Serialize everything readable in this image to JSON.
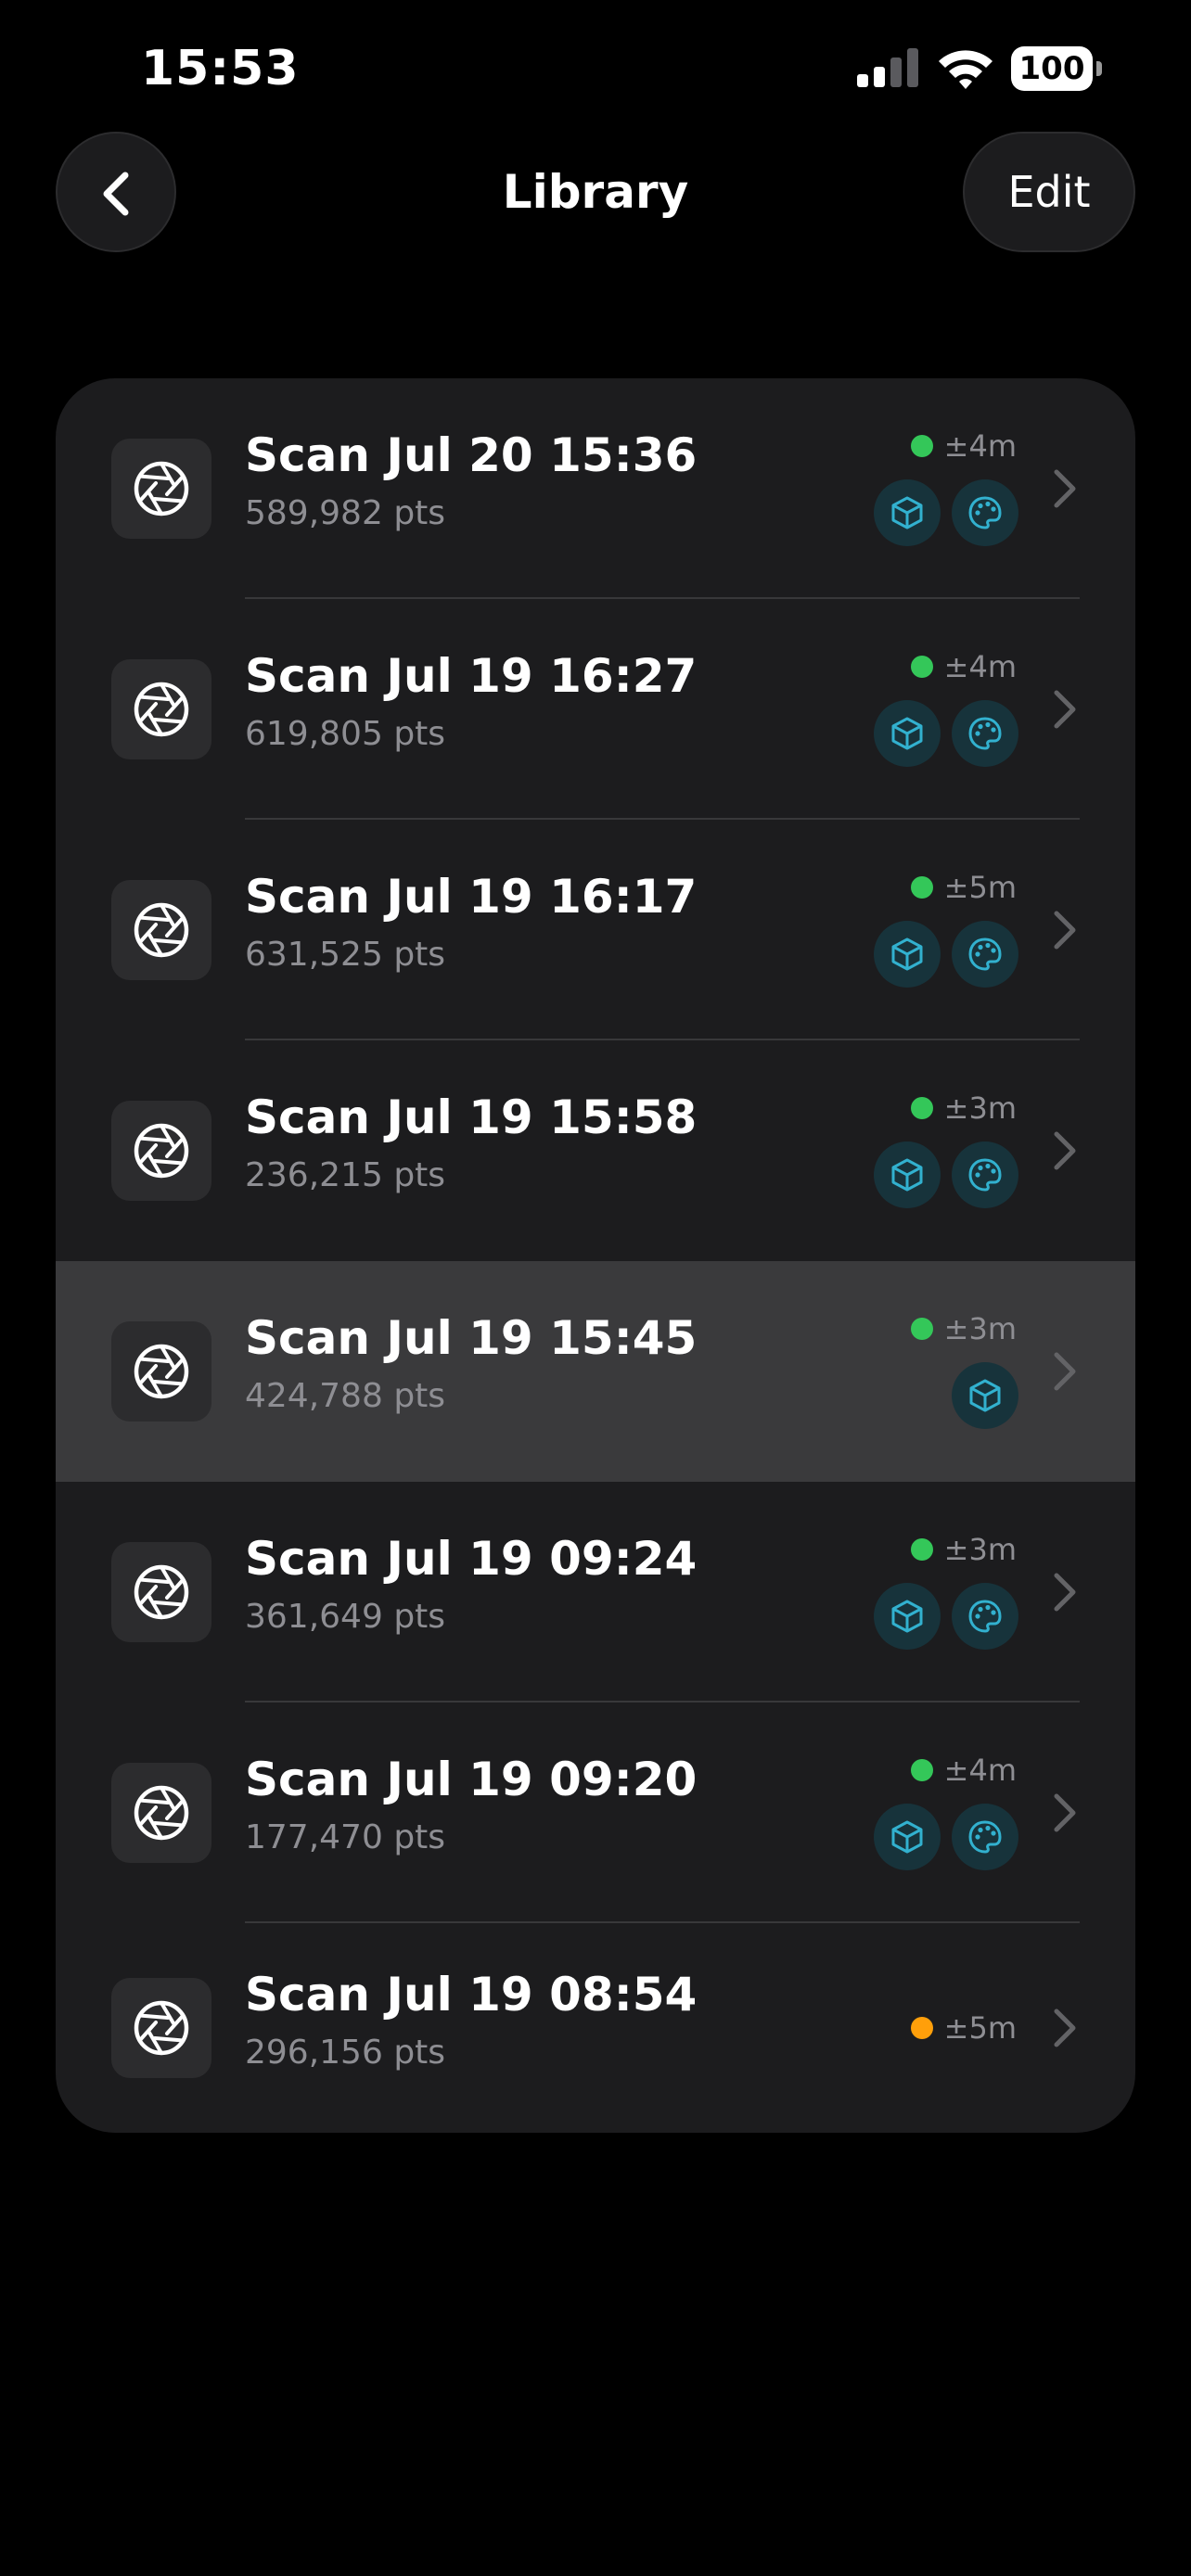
{
  "status_bar": {
    "time": "15:53",
    "battery": "100"
  },
  "nav": {
    "title": "Library",
    "edit_label": "Edit"
  },
  "colors": {
    "accuracy_good": "#34c759",
    "accuracy_warn": "#ff9f0a",
    "badge_icon": "#32b1cf"
  },
  "scans": [
    {
      "title": "Scan Jul 20 15:36",
      "points": "589,982 pts",
      "accuracy": "±4m",
      "status": "green",
      "badges": [
        "mesh-cube-icon",
        "palette-icon"
      ]
    },
    {
      "title": "Scan Jul 19 16:27",
      "points": "619,805 pts",
      "accuracy": "±4m",
      "status": "green",
      "badges": [
        "mesh-cube-icon",
        "palette-icon"
      ]
    },
    {
      "title": "Scan Jul 19 16:17",
      "points": "631,525 pts",
      "accuracy": "±5m",
      "status": "green",
      "badges": [
        "mesh-cube-icon",
        "palette-icon"
      ]
    },
    {
      "title": "Scan Jul 19 15:58",
      "points": "236,215 pts",
      "accuracy": "±3m",
      "status": "green",
      "badges": [
        "mesh-cube-icon",
        "palette-icon"
      ]
    },
    {
      "title": "Scan Jul 19 15:45",
      "points": "424,788 pts",
      "accuracy": "±3m",
      "status": "green",
      "badges": [
        "mesh-cube-icon"
      ],
      "selected": true
    },
    {
      "title": "Scan Jul 19 09:24",
      "points": "361,649 pts",
      "accuracy": "±3m",
      "status": "green",
      "badges": [
        "mesh-cube-icon",
        "palette-icon"
      ]
    },
    {
      "title": "Scan Jul 19 09:20",
      "points": "177,470 pts",
      "accuracy": "±4m",
      "status": "green",
      "badges": [
        "mesh-cube-icon",
        "palette-icon"
      ]
    },
    {
      "title": "Scan Jul 19 08:54",
      "points": "296,156 pts",
      "accuracy": "±5m",
      "status": "orange",
      "badges": []
    }
  ]
}
